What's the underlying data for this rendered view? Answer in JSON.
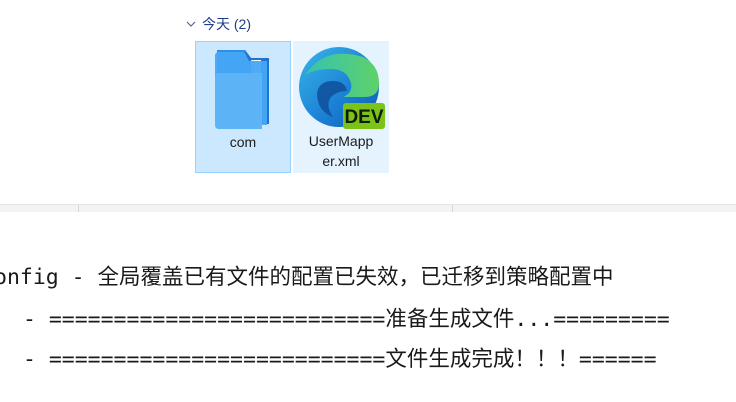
{
  "explorer": {
    "group": {
      "label": "今天 (2)"
    },
    "files": [
      {
        "name": "com",
        "icon": "folder-icon",
        "state": "selected"
      },
      {
        "name": "UserMapper.xml",
        "name_line1": "UserMapp",
        "name_line2": "er.xml",
        "icon": "edge-dev-icon",
        "badge": "DEV",
        "state": "hover"
      }
    ]
  },
  "console": {
    "lines": [
      "onfig - 全局覆盖已有文件的配置已失效，已迁移到策略配置中",
      " - ==========================准备生成文件...=========",
      " - ==========================文件生成完成！！！======"
    ]
  },
  "colors": {
    "group_header": "#1e3f8a",
    "selection_bg": "#cce8ff",
    "selection_border": "#99d1ff",
    "hover_bg": "#e5f3ff",
    "badge_bg": "#7cc318",
    "folder_blue": "#3b9cf0"
  }
}
